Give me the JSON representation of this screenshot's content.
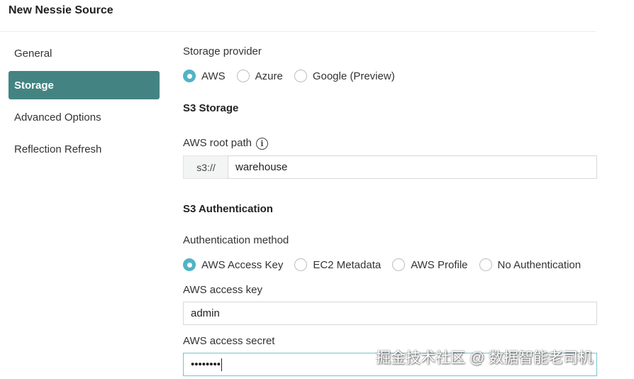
{
  "dialog": {
    "title": "New Nessie Source"
  },
  "nav": {
    "items": [
      {
        "label": "General",
        "active": false
      },
      {
        "label": "Storage",
        "active": true
      },
      {
        "label": "Advanced Options",
        "active": false
      },
      {
        "label": "Reflection Refresh",
        "active": false
      }
    ]
  },
  "storage": {
    "provider_label": "Storage provider",
    "providers": [
      {
        "label": "AWS",
        "checked": true
      },
      {
        "label": "Azure",
        "checked": false
      },
      {
        "label": "Google (Preview)",
        "checked": false
      }
    ],
    "s3_heading": "S3 Storage",
    "root_path_label": "AWS root path",
    "root_path_prefix": "s3://",
    "root_path_value": "warehouse",
    "auth_heading": "S3 Authentication",
    "auth_method_label": "Authentication method",
    "auth_methods": [
      {
        "label": "AWS Access Key",
        "checked": true
      },
      {
        "label": "EC2 Metadata",
        "checked": false
      },
      {
        "label": "AWS Profile",
        "checked": false
      },
      {
        "label": "No Authentication",
        "checked": false
      }
    ],
    "access_key_label": "AWS access key",
    "access_key_value": "admin",
    "access_secret_label": "AWS access secret",
    "access_secret_value": "••••••••"
  },
  "watermark": "掘金技术社区 @ 数据智能老司机",
  "colors": {
    "accent": "#438482",
    "radio_checked": "#51b3c6"
  }
}
